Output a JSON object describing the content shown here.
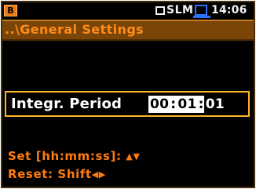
{
  "status_bar": {
    "app_icon": "orange-square-icon",
    "mode_indicator_icon": "square-outline-icon",
    "mode": "SLM",
    "battery_icon": "blue-square-icon",
    "time": "14:06"
  },
  "title": "..\\General Settings",
  "parameter": {
    "label": "Integr. Period",
    "value": {
      "hh": "00",
      "sep1": ":",
      "mm": "01",
      "sep2": ":",
      "ss": "01"
    }
  },
  "hints": {
    "set": {
      "text": "Set [hh:mm:ss]:",
      "up_arrow": "▲",
      "down_arrow": "▼"
    },
    "reset": {
      "text": "Reset: Shift",
      "left_arrow": "◀",
      "right_arrow": "▶"
    }
  },
  "colors": {
    "background": "#000000",
    "title_bar": "#7a4506",
    "accent_orange": "#ff7b10",
    "highlight_border": "#ffb72a",
    "battery_blue": "#2f6fff"
  }
}
